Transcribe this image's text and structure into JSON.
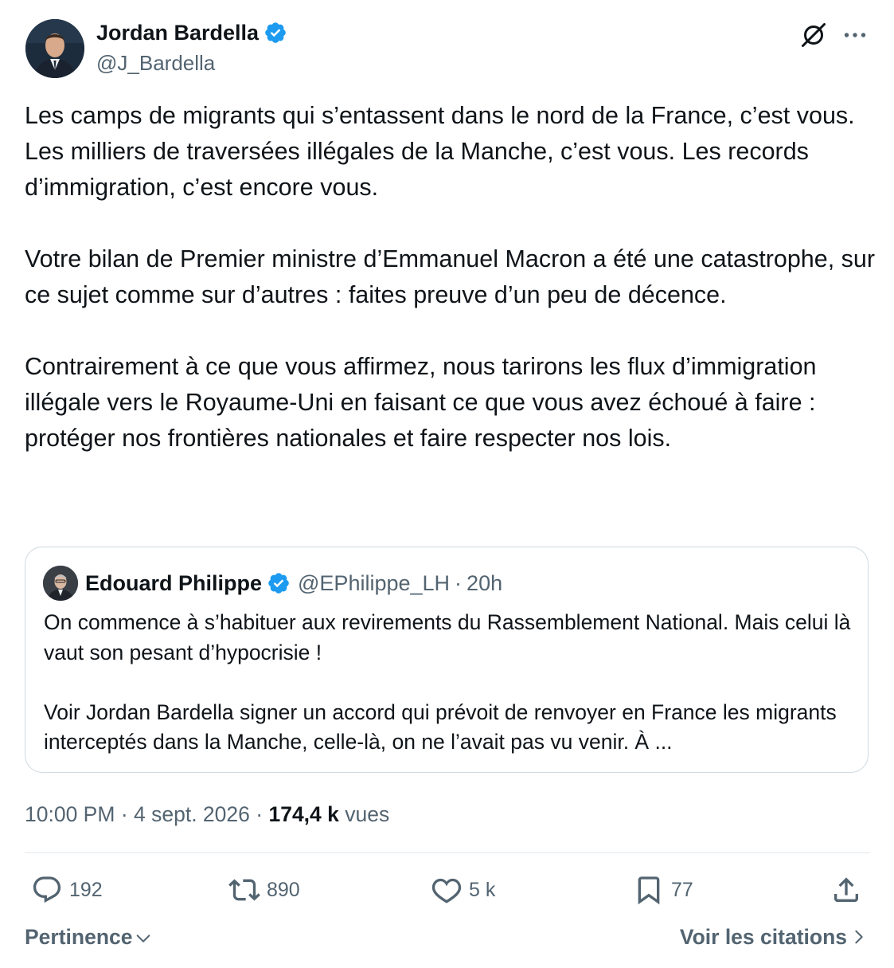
{
  "author": {
    "display_name": "Jordan Bardella",
    "handle": "@J_Bardella"
  },
  "tweet": {
    "paragraphs": [
      "Les camps de migrants qui s’entassent dans le nord de la France, c’est vous. Les milliers de traversées illégales de la Manche, c’est vous. Les records d’immigration, c’est encore vous.",
      "Votre bilan de Premier ministre d’Emmanuel Macron a été une catastrophe, sur ce sujet comme sur d’autres : faites preuve d’un peu de décence.",
      "Contrairement à ce que vous affirmez, nous tarirons les flux d’immigration illégale vers le Royaume-Uni en faisant ce que vous avez échoué à faire : protéger nos frontières nationales et faire respecter nos lois."
    ]
  },
  "quote": {
    "display_name": "Edouard Philippe",
    "handle": "@EPhilippe_LH",
    "separator": "·",
    "time": "20h",
    "paragraphs": [
      "On commence à s’habituer aux revirements du Rassemblement National. Mais celui là vaut son pesant d’hypocrisie !",
      "Voir Jordan Bardella signer un accord qui prévoit de renvoyer en France les migrants interceptés dans la Manche, celle-là, on ne l’avait pas vu venir. À ..."
    ]
  },
  "meta": {
    "time": "10:00 PM",
    "separator": "·",
    "date": "4 sept. 2026",
    "views_count": "174,4 k",
    "views_label": "vues"
  },
  "actions": {
    "replies": "192",
    "retweets": "890",
    "likes": "5 k",
    "bookmarks": "77"
  },
  "footer": {
    "sort_label": "Pertinence",
    "quotes_link": "Voir les citations"
  },
  "icons": {
    "verified": "verified-badge-icon",
    "grok": "grok-icon",
    "more": "more-icon",
    "reply": "reply-icon",
    "retweet": "retweet-icon",
    "like": "heart-icon",
    "bookmark": "bookmark-icon",
    "share": "share-icon",
    "sort_chevron": "chevron-down-icon",
    "quotes_chevron": "chevron-right-icon"
  },
  "colors": {
    "verified_blue": "#1d9bf0",
    "text_primary": "#0f1419",
    "text_secondary": "#536471",
    "border": "#cfd9de"
  }
}
